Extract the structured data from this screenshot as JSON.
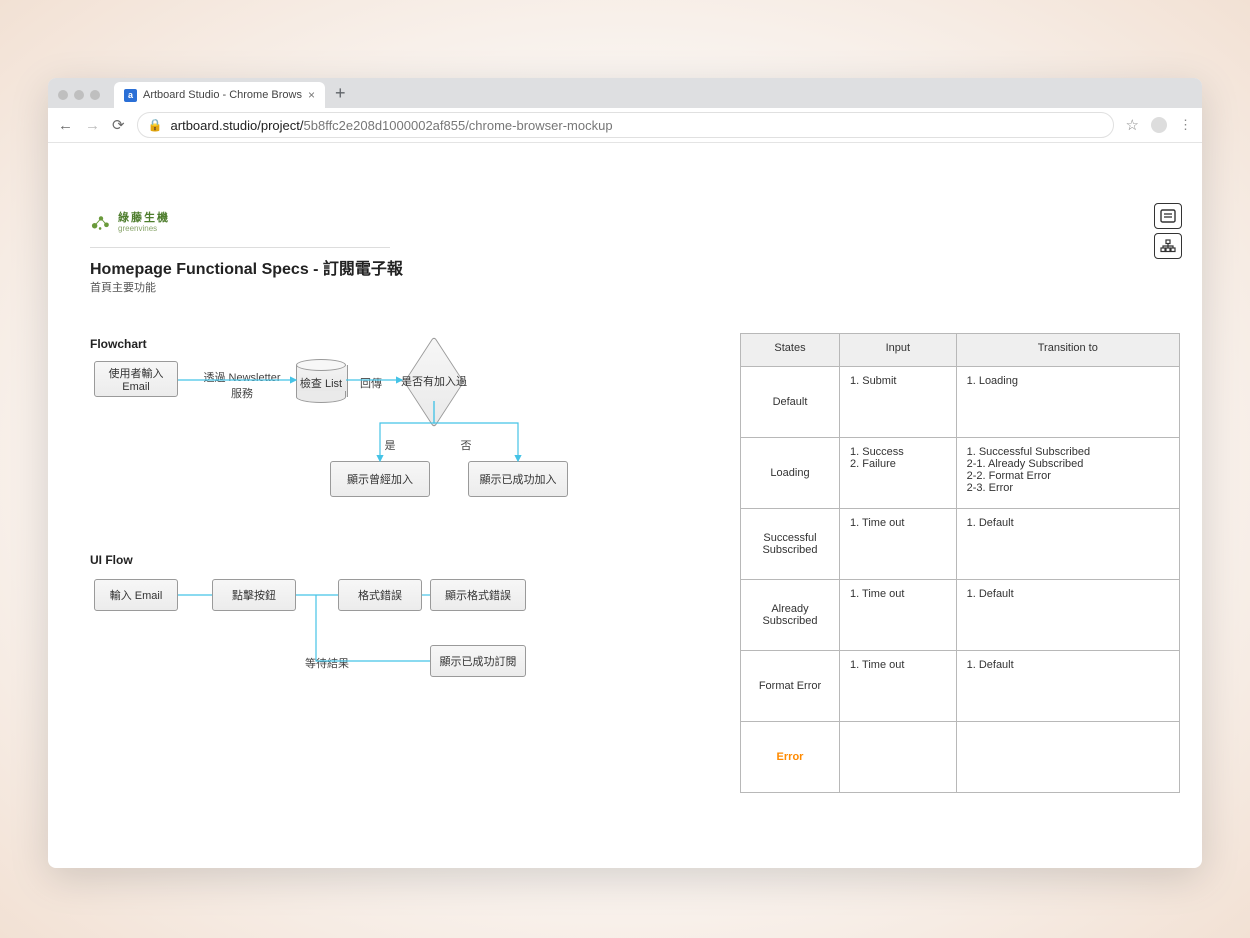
{
  "browser": {
    "tab_title": "Artboard Studio - Chrome Brows",
    "url_display": "artboard.studio/project/5b8ffc2e208d1000002af855/chrome-browser-mockup",
    "url_host": "artboard.studio/project/",
    "url_path": "5b8ffc2e208d1000002af855/chrome-browser-mockup"
  },
  "logo": {
    "brand_cn": "綠藤生機",
    "brand_en": "greenvines"
  },
  "header": {
    "title": "Homepage Functional Specs - 訂閱電子報",
    "subtitle": "首頁主要功能"
  },
  "sections": {
    "flowchart": "Flowchart",
    "uiflow": "UI Flow"
  },
  "flowchart": {
    "start": "使用者輸入\nEmail",
    "edge1": "透過 Newsletter\n服務",
    "db": "檢查 List",
    "edge2": "回傳",
    "decision": "是否有加入過",
    "yes": "是",
    "no": "否",
    "already": "顯示曾經加入",
    "success": "顯示已成功加入"
  },
  "uiflow": {
    "n1": "輸入 Email",
    "n2": "點擊按鈕",
    "n3": "格式錯誤",
    "n4": "顯示格式錯誤",
    "wait": "等待結果",
    "n5": "顯示已成功訂閱"
  },
  "table": {
    "headers": {
      "c1": "States",
      "c2": "Input",
      "c3": "Transition to"
    },
    "rows": [
      {
        "state": "Default",
        "input": "1. Submit",
        "to": "1. Loading"
      },
      {
        "state": "Loading",
        "input": "1. Success\n2. Failure",
        "to": "1. Successful Subscribed\n2-1. Already Subscribed\n2-2. Format Error\n2-3. Error"
      },
      {
        "state": "Successful\nSubscribed",
        "input": "1. Time out",
        "to": "1. Default"
      },
      {
        "state": "Already\nSubscribed",
        "input": "1. Time out",
        "to": "1. Default"
      },
      {
        "state": "Format Error",
        "input": "1. Time out",
        "to": "1. Default"
      },
      {
        "state": "Error",
        "input": "",
        "to": "",
        "error": true
      }
    ]
  },
  "chart_data": {
    "type": "table",
    "title": "State Transition Table — 訂閱電子報",
    "columns": [
      "States",
      "Input",
      "Transition to"
    ],
    "rows": [
      [
        "Default",
        "1. Submit",
        "1. Loading"
      ],
      [
        "Loading",
        "1. Success; 2. Failure",
        "1. Successful Subscribed; 2-1. Already Subscribed; 2-2. Format Error; 2-3. Error"
      ],
      [
        "Successful Subscribed",
        "1. Time out",
        "1. Default"
      ],
      [
        "Already Subscribed",
        "1. Time out",
        "1. Default"
      ],
      [
        "Format Error",
        "1. Time out",
        "1. Default"
      ],
      [
        "Error",
        "",
        ""
      ]
    ]
  }
}
